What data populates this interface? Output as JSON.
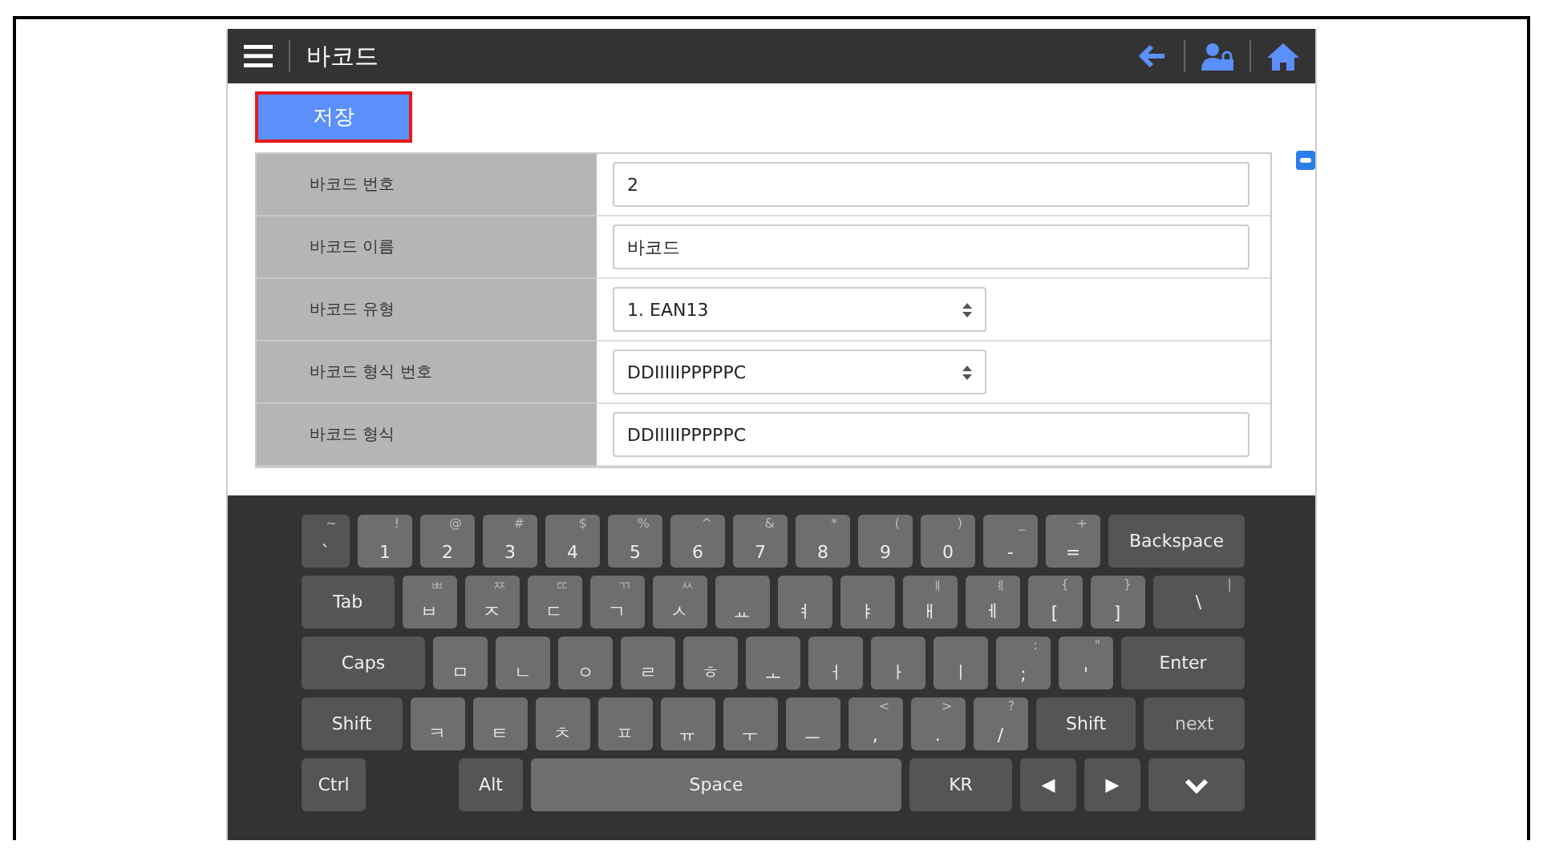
{
  "header": {
    "title": "바코드"
  },
  "save_button": "저장",
  "form": {
    "rows": [
      {
        "label": "바코드 번호",
        "kind": "input",
        "value": "2"
      },
      {
        "label": "바코드 이름",
        "kind": "input",
        "value": "바코드"
      },
      {
        "label": "바코드 유형",
        "kind": "select",
        "value": "1. EAN13"
      },
      {
        "label": "바코드 형식 번호",
        "kind": "select",
        "value": "DDIIIIIPPPPPC"
      },
      {
        "label": "바코드 형식",
        "kind": "input",
        "value": "DDIIIIIPPPPPC"
      }
    ]
  },
  "keyboard": {
    "rows": [
      [
        {
          "kind": "edge",
          "main": "`",
          "shift": "~"
        },
        {
          "kind": "char",
          "main": "1",
          "shift": "!"
        },
        {
          "kind": "char",
          "main": "2",
          "shift": "@"
        },
        {
          "kind": "char",
          "main": "3",
          "shift": "#"
        },
        {
          "kind": "char",
          "main": "4",
          "shift": "$"
        },
        {
          "kind": "char",
          "main": "5",
          "shift": "%"
        },
        {
          "kind": "char",
          "main": "6",
          "shift": "^"
        },
        {
          "kind": "char",
          "main": "7",
          "shift": "&"
        },
        {
          "kind": "char",
          "main": "8",
          "shift": "*"
        },
        {
          "kind": "char",
          "main": "9",
          "shift": "("
        },
        {
          "kind": "char",
          "main": "0",
          "shift": ")"
        },
        {
          "kind": "char",
          "main": "-",
          "shift": "_"
        },
        {
          "kind": "char",
          "main": "=",
          "shift": "+"
        },
        {
          "kind": "fn",
          "main": "Backspace"
        }
      ],
      [
        {
          "kind": "fn",
          "main": "Tab"
        },
        {
          "kind": "char",
          "main": "ㅂ",
          "shift": "ㅃ"
        },
        {
          "kind": "char",
          "main": "ㅈ",
          "shift": "ㅉ"
        },
        {
          "kind": "char",
          "main": "ㄷ",
          "shift": "ㄸ"
        },
        {
          "kind": "char",
          "main": "ㄱ",
          "shift": "ㄲ"
        },
        {
          "kind": "char",
          "main": "ㅅ",
          "shift": "ㅆ"
        },
        {
          "kind": "char",
          "main": "ㅛ"
        },
        {
          "kind": "char",
          "main": "ㅕ"
        },
        {
          "kind": "char",
          "main": "ㅑ"
        },
        {
          "kind": "char",
          "main": "ㅐ",
          "shift": "ㅒ"
        },
        {
          "kind": "char",
          "main": "ㅔ",
          "shift": "ㅖ"
        },
        {
          "kind": "char",
          "main": "[",
          "shift": "{"
        },
        {
          "kind": "char",
          "main": "]",
          "shift": "}"
        },
        {
          "kind": "fn",
          "main": "\\",
          "shift": "|"
        }
      ],
      [
        {
          "kind": "fn",
          "main": "Caps"
        },
        {
          "kind": "char",
          "main": "ㅁ"
        },
        {
          "kind": "char",
          "main": "ㄴ"
        },
        {
          "kind": "char",
          "main": "ㅇ"
        },
        {
          "kind": "char",
          "main": "ㄹ"
        },
        {
          "kind": "char",
          "main": "ㅎ"
        },
        {
          "kind": "char",
          "main": "ㅗ"
        },
        {
          "kind": "char",
          "main": "ㅓ"
        },
        {
          "kind": "char",
          "main": "ㅏ"
        },
        {
          "kind": "char",
          "main": "ㅣ"
        },
        {
          "kind": "char",
          "main": ";",
          "shift": ":"
        },
        {
          "kind": "char",
          "main": "'",
          "shift": "\""
        },
        {
          "kind": "fn",
          "main": "Enter"
        }
      ],
      [
        {
          "kind": "fn",
          "main": "Shift"
        },
        {
          "kind": "char",
          "main": "ㅋ"
        },
        {
          "kind": "char",
          "main": "ㅌ"
        },
        {
          "kind": "char",
          "main": "ㅊ"
        },
        {
          "kind": "char",
          "main": "ㅍ"
        },
        {
          "kind": "char",
          "main": "ㅠ"
        },
        {
          "kind": "char",
          "main": "ㅜ"
        },
        {
          "kind": "char",
          "main": "ㅡ"
        },
        {
          "kind": "char",
          "main": ",",
          "shift": "<"
        },
        {
          "kind": "char",
          "main": ".",
          "shift": ">"
        },
        {
          "kind": "char",
          "main": "/",
          "shift": "?"
        },
        {
          "kind": "fn",
          "main": "Shift"
        },
        {
          "kind": "next",
          "main": "next"
        }
      ],
      [
        {
          "kind": "ctrl",
          "main": "Ctrl"
        },
        {
          "kind": "alt",
          "main": "Alt"
        },
        {
          "kind": "space",
          "main": "Space"
        },
        {
          "kind": "lang",
          "main": "KR"
        },
        {
          "kind": "arrow",
          "main": "◀"
        },
        {
          "kind": "arrow",
          "main": "▶"
        },
        {
          "kind": "hide"
        }
      ]
    ]
  }
}
